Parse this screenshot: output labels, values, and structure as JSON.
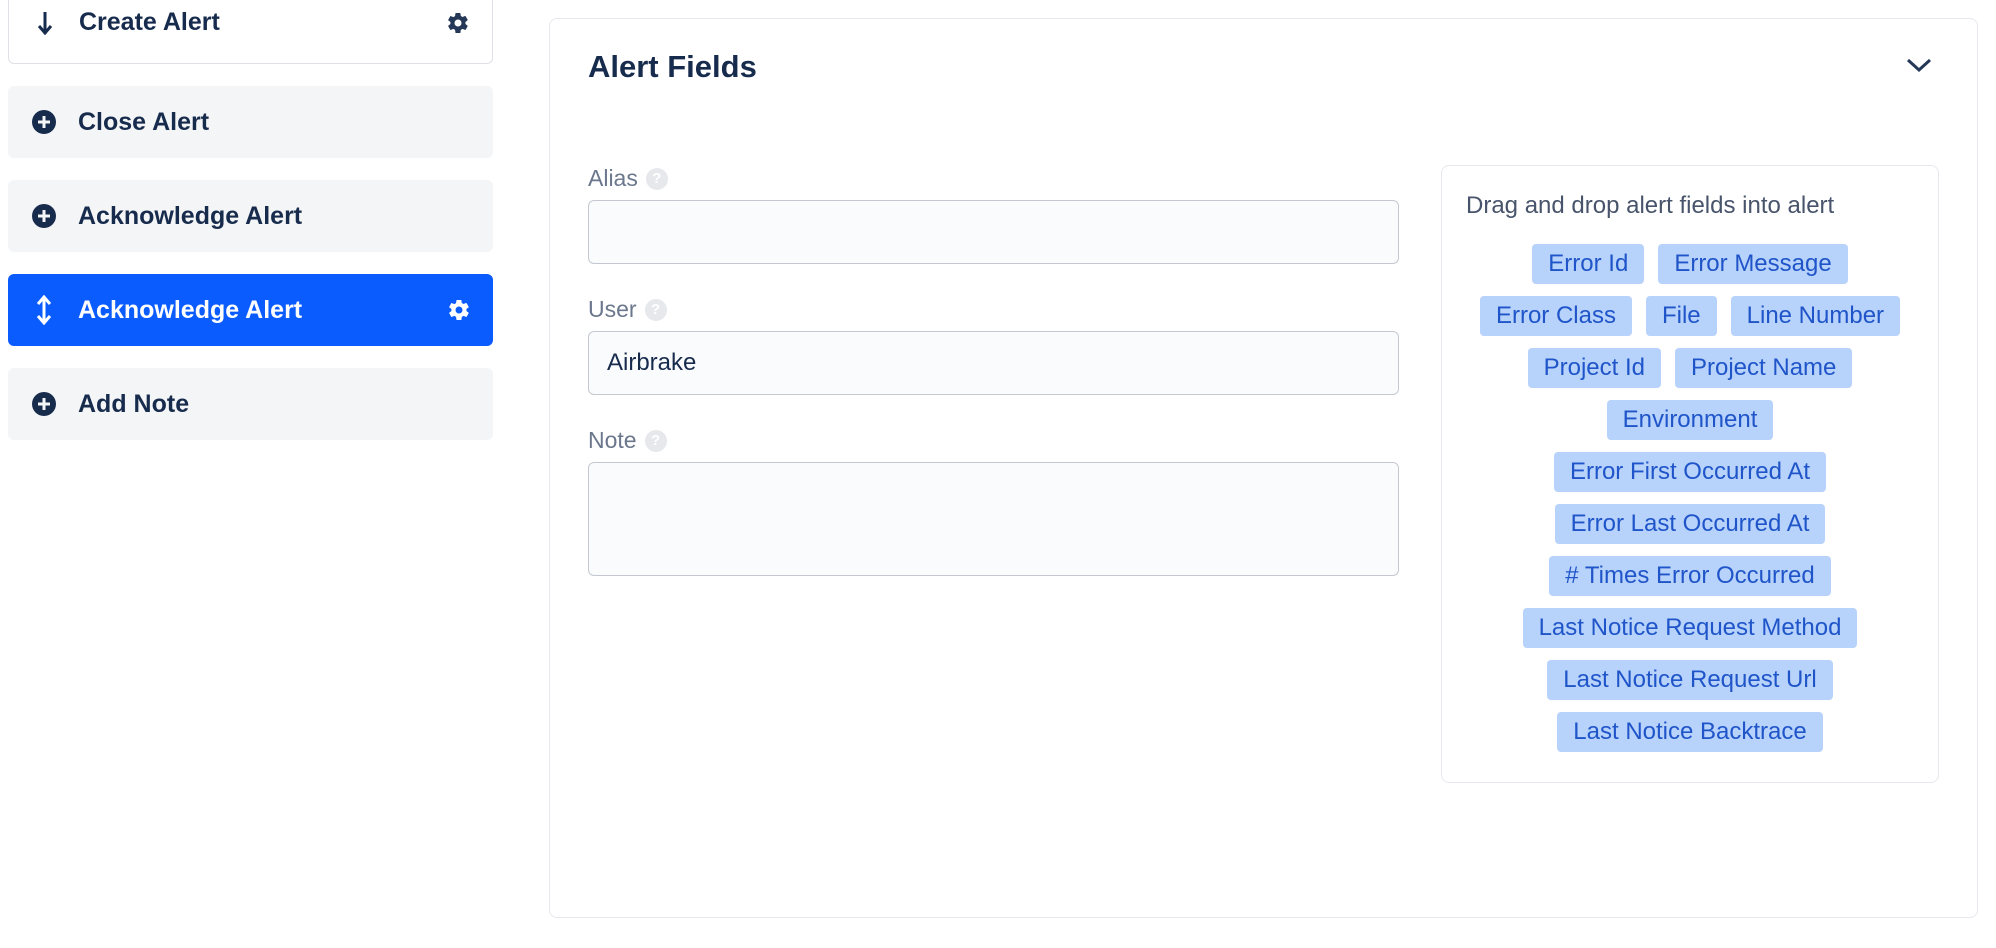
{
  "sidebar": {
    "createAlert": "Create Alert",
    "closeAlert": "Close Alert",
    "ackAlert": "Acknowledge Alert",
    "ackAlertSelected": "Acknowledge Alert",
    "addNote": "Add Note"
  },
  "panel": {
    "title": "Alert Fields",
    "fields": {
      "aliasLabel": "Alias",
      "aliasValue": "",
      "userLabel": "User",
      "userValue": "Airbrake",
      "noteLabel": "Note",
      "noteValue": ""
    },
    "palette": {
      "title": "Drag and drop alert fields into alert",
      "tags": [
        "Error Id",
        "Error Message",
        "Error Class",
        "File",
        "Line Number",
        "Project Id",
        "Project Name",
        "Environment",
        "Error First Occurred At",
        "Error Last Occurred At",
        "# Times Error Occurred",
        "Last Notice Request Method",
        "Last Notice Request Url",
        "Last Notice Backtrace"
      ]
    }
  }
}
